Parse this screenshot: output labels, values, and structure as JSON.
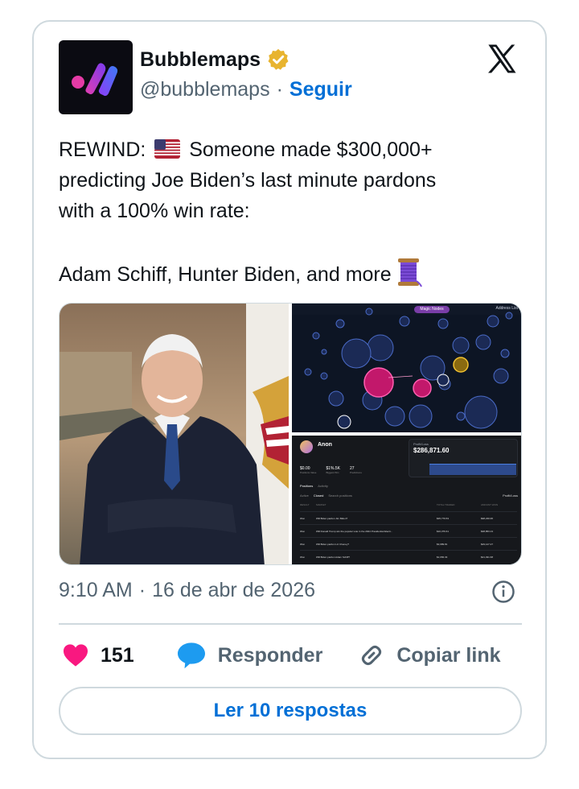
{
  "author": {
    "name": "Bubblemaps",
    "handle": "@bubblemaps",
    "separator": "·",
    "follow_label": "Seguir"
  },
  "tweet": {
    "line1_prefix": "REWIND: ",
    "line1_rest": " Someone made $300,000+",
    "line2": "predicting Joe Biden’s last minute pardons",
    "line3": "with a 100% win rate:",
    "line4": "Adam Schiff, Hunter Biden, and more"
  },
  "media": {
    "top_right": {
      "tab_label": "Magic Nodes",
      "address_list_label": "Address List"
    },
    "bottom_right": {
      "profile_name": "Anon",
      "pl_label": "Profit/Loss",
      "pl_value": "$286,871.60",
      "stats": [
        {
          "value": "$0.00",
          "label": "Positions Value"
        },
        {
          "value": "$1%.5K",
          "label": "Biggest Win"
        },
        {
          "value": "27",
          "label": "Predictions"
        }
      ],
      "tabs": [
        "Positions",
        "Activity"
      ],
      "subtabs": [
        "Active",
        "Closed"
      ],
      "search_placeholder": "Search positions",
      "sort_label": "Profit/Loss",
      "columns": [
        "RESULT",
        "MARKET",
        "TOTAL TRADED",
        "AMOUNT WON"
      ],
      "rows": [
        {
          "result": "Won",
          "market": "Will Biden pardon Jim Biden?",
          "traded": "$35,779.53",
          "won": "$98,239.95"
        },
        {
          "result": "Won",
          "market": "Will Donald Trump win the popular vote in the 2024 Presidential Electi...",
          "traded": "$10,376.61",
          "won": "$38,853.13"
        },
        {
          "result": "Won",
          "market": "Will Biden pardon Liz Cheney?",
          "traded": "$3,989.81",
          "won": "$29,127.27"
        },
        {
          "result": "Won",
          "market": "Will Biden pardon Adam Schiff?",
          "traded": "$1,656.33",
          "won": "$21,491.68"
        }
      ]
    }
  },
  "timestamp": {
    "time": "9:10 AM",
    "separator": "·",
    "date": "16 de abr de 2026"
  },
  "actions": {
    "like_count": "151",
    "reply_label": "Responder",
    "copy_label": "Copiar link"
  },
  "replies_button": "Ler 10 respostas",
  "colors": {
    "link_blue": "#006fd6",
    "like_pink": "#f91880",
    "reply_blue": "#1d9bf0",
    "muted": "#536471",
    "border": "#cfd9de"
  }
}
